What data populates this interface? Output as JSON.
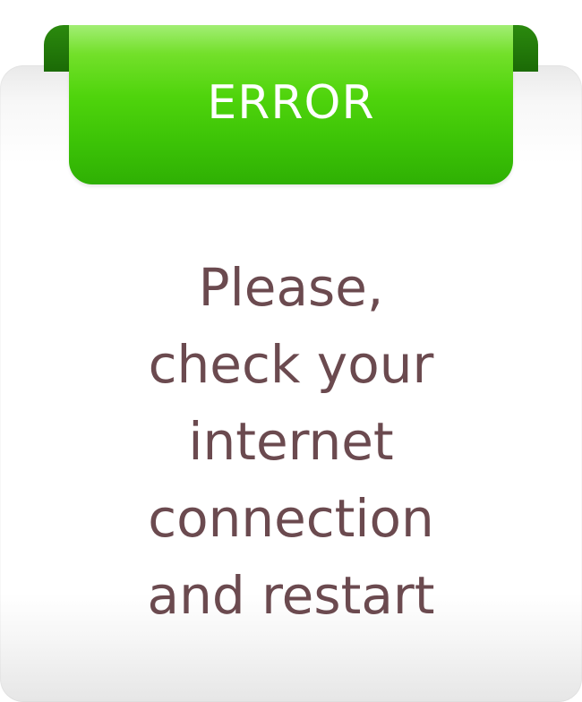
{
  "banner": {
    "title": "ERROR"
  },
  "message": {
    "lines": [
      "Please,",
      "check your",
      "internet",
      "connection",
      "and restart"
    ]
  },
  "colors": {
    "ribbon": "#4fd40c",
    "ribbon_fold": "#1f7308",
    "message_text": "#6b4a4f",
    "card": "#ffffff"
  }
}
